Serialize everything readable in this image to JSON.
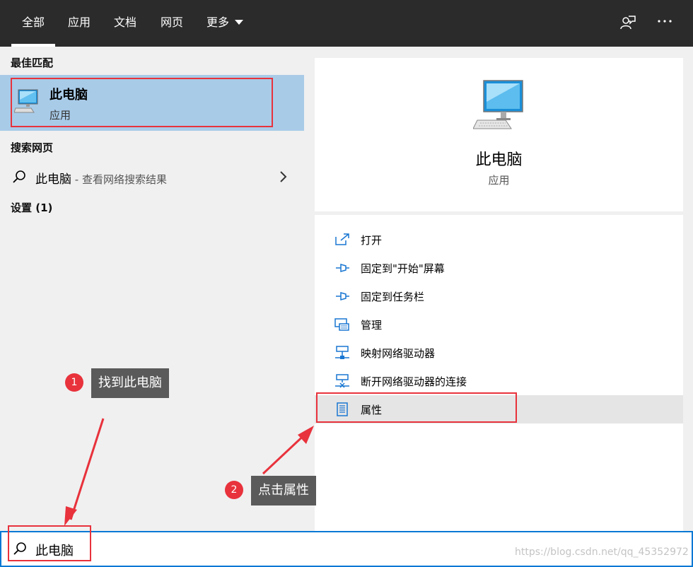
{
  "tabs": [
    {
      "label": "全部",
      "active": true
    },
    {
      "label": "应用"
    },
    {
      "label": "文档"
    },
    {
      "label": "网页"
    },
    {
      "label": "更多"
    }
  ],
  "left": {
    "best_match_title": "最佳匹配",
    "best_match": {
      "name": "此电脑",
      "type": "应用"
    },
    "web_title": "搜索网页",
    "web_item": {
      "query": "此电脑",
      "suffix": " - 查看网络搜索结果"
    },
    "settings_title": "设置 (1)"
  },
  "right": {
    "name": "此电脑",
    "type": "应用",
    "actions": [
      {
        "label": "打开",
        "icon": "open-icon"
      },
      {
        "label": "固定到\"开始\"屏幕",
        "icon": "pin-icon"
      },
      {
        "label": "固定到任务栏",
        "icon": "pin-icon"
      },
      {
        "label": "管理",
        "icon": "manage-icon"
      },
      {
        "label": "映射网络驱动器",
        "icon": "network-drive-icon"
      },
      {
        "label": "断开网络驱动器的连接",
        "icon": "disconnect-drive-icon"
      },
      {
        "label": "属性",
        "icon": "properties-icon",
        "highlighted": true
      }
    ]
  },
  "search": {
    "value": "此电脑"
  },
  "annotations": [
    {
      "number": "1",
      "text": "找到此电脑"
    },
    {
      "number": "2",
      "text": "点击属性"
    }
  ],
  "watermark": "https://blog.csdn.net/qq_45352972",
  "colors": {
    "topbar": "#2b2b2b",
    "selection": "#a8cbe8",
    "accent": "#0a78d4",
    "annotation_red": "#e8323c"
  }
}
